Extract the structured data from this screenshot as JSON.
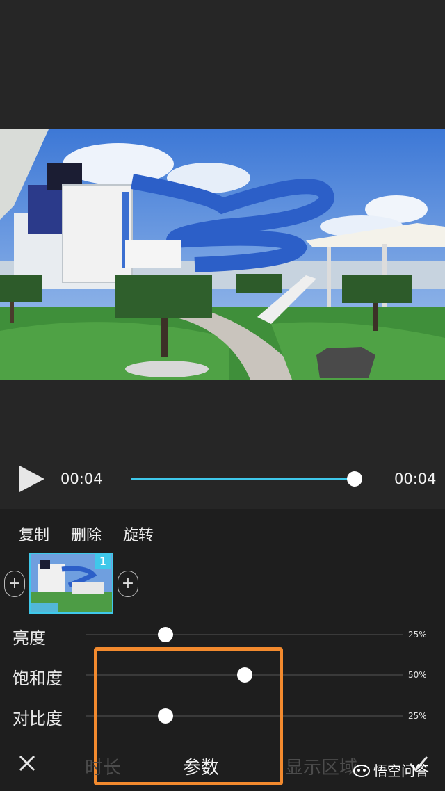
{
  "player": {
    "current_time": "00:04",
    "total_time": "00:04",
    "progress": 1.0
  },
  "actions": {
    "copy": "复制",
    "delete": "删除",
    "rotate": "旋转"
  },
  "clips": [
    {
      "index": "1",
      "selected": true
    }
  ],
  "adjustments": [
    {
      "label": "亮度",
      "value": "25%",
      "level": 0.25
    },
    {
      "label": "饱和度",
      "value": "50%",
      "level": 0.5
    },
    {
      "label": "对比度",
      "value": "25%",
      "level": 0.25
    }
  ],
  "tabs": {
    "duration": "时长",
    "params": "参数",
    "display_area": "显示区域"
  },
  "watermark": "悟空问答",
  "colors": {
    "accent": "#3fc8ea",
    "highlight": "#f28a2e",
    "background": "#262626"
  },
  "icons": {
    "play": "play-icon",
    "add": "plus-icon",
    "close": "close-icon",
    "confirm": "check-icon"
  }
}
